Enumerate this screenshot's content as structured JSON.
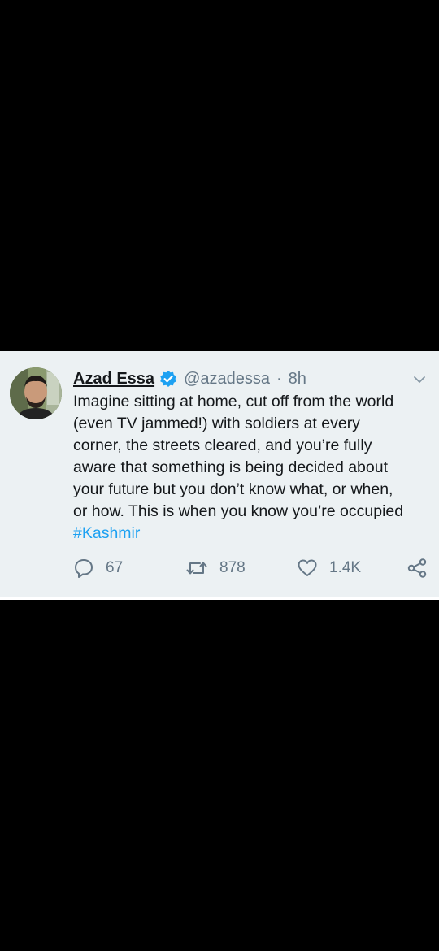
{
  "tweet": {
    "display_name": "Azad Essa",
    "handle": "@azadessa",
    "separator": "·",
    "time": "8h",
    "text_lines": [
      "Imagine sitting at home, cut off from the world",
      "(even TV jammed!) with soldiers at every",
      "corner, the streets cleared, and you’re fully",
      "aware that something is being decided about",
      "your future but you don’t know what, or when,",
      "or how. This is when you know you’re occupied"
    ],
    "hashtag": "#Kashmir",
    "reply_count": "67",
    "retweet_count": "878",
    "like_count": "1.4K"
  },
  "icons": {
    "verified": "verified-badge-icon",
    "menu": "chevron-down-icon",
    "reply": "reply-icon",
    "retweet": "retweet-icon",
    "like": "heart-icon",
    "share": "share-icon"
  },
  "colors": {
    "card_background": "#ecf1f3",
    "text": "#14171a",
    "secondary_text": "#657786",
    "link": "#1da1f2",
    "verified": "#1da1f2",
    "screen_background": "#000000"
  }
}
